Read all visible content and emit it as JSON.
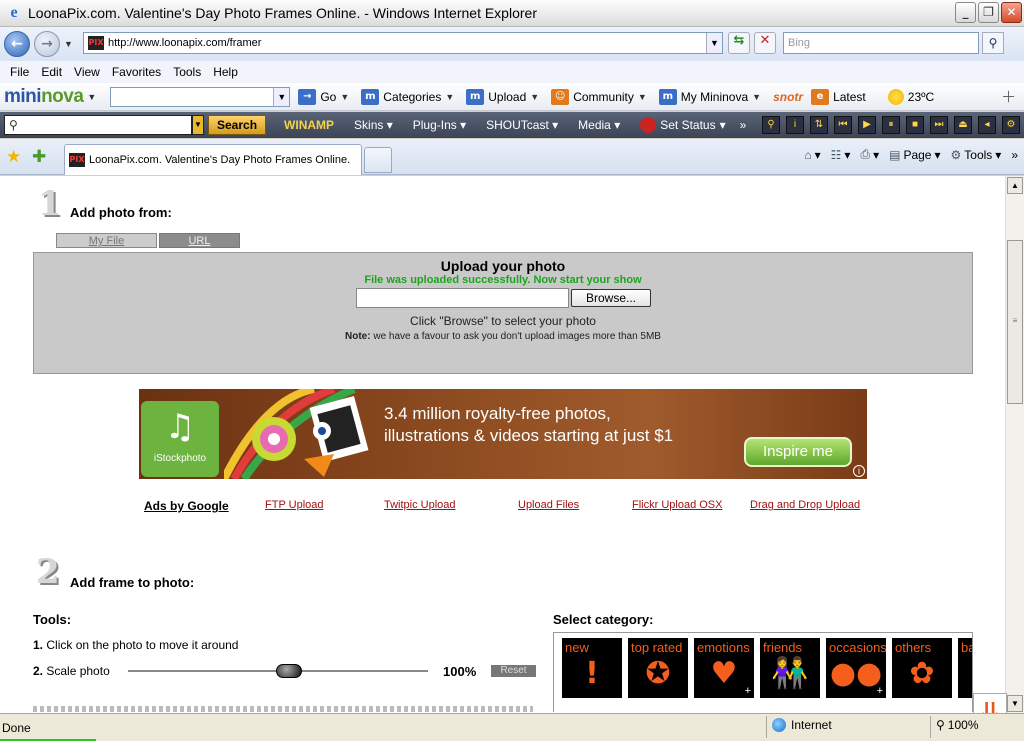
{
  "window": {
    "title": "LoonaPix.com. Valentine's Day Photo Frames Online. - Windows Internet Explorer"
  },
  "address": {
    "url": "http://www.loonapix.com/framer",
    "search_placeholder": "Bing"
  },
  "menu": [
    "File",
    "Edit",
    "View",
    "Favorites",
    "Tools",
    "Help"
  ],
  "mininova": {
    "logo_a": "mini",
    "logo_b": "nova",
    "go": "Go",
    "categories": "Categories",
    "upload": "Upload",
    "community": "Community",
    "my_mininova": "My Mininova",
    "latest": "Latest",
    "weather": "23ºC",
    "snotr": "snotr"
  },
  "winamp": {
    "search_button": "Search",
    "logo": "WINAMP",
    "items": [
      "Skins",
      "Plug-Ins",
      "SHOUTcast",
      "Media",
      "Set Status"
    ]
  },
  "tab": {
    "title": "LoonaPix.com. Valentine's Day Photo Frames Online."
  },
  "commands": {
    "page": "Page",
    "tools": "Tools"
  },
  "step1": {
    "num": "1",
    "title": "Add photo from:",
    "tab_myfile": "My File",
    "tab_url": "URL",
    "heading": "Upload your photo",
    "success": "File was uploaded successfully. Now start your show",
    "browse": "Browse...",
    "hint": "Click \"Browse\" to select your photo",
    "note_label": "Note:",
    "note": "we have a favour to ask you don't upload images more than 5MB"
  },
  "ad": {
    "brand": "iStockphoto",
    "line1": "3.4 million royalty-free photos,",
    "line2": "illustrations & videos starting at just $1",
    "cta": "Inspire me"
  },
  "links": {
    "ads_by": "Ads by Google",
    "items": [
      "FTP Upload",
      "Twitpic Upload",
      "Upload Files",
      "Flickr Upload OSX",
      "Drag and Drop Upload"
    ]
  },
  "step2": {
    "num": "2",
    "title": "Add frame to photo:",
    "tools_label": "Tools:",
    "tool1_num": "1.",
    "tool1": "Click on the photo to move it around",
    "tool2_num": "2.",
    "tool2": "Scale photo",
    "scale": 1.0,
    "scale_text": "100%",
    "reset": "Reset",
    "category_label": "Select category:",
    "categories": [
      "new",
      "top rated",
      "emotions",
      "friends",
      "occasions",
      "others",
      "ba"
    ]
  },
  "status": {
    "text": "Done",
    "zone": "Internet",
    "zoom": "100%"
  },
  "colors": {
    "success": "#1ca41c",
    "link": "#a01010",
    "category_text": "#f45f1e"
  }
}
